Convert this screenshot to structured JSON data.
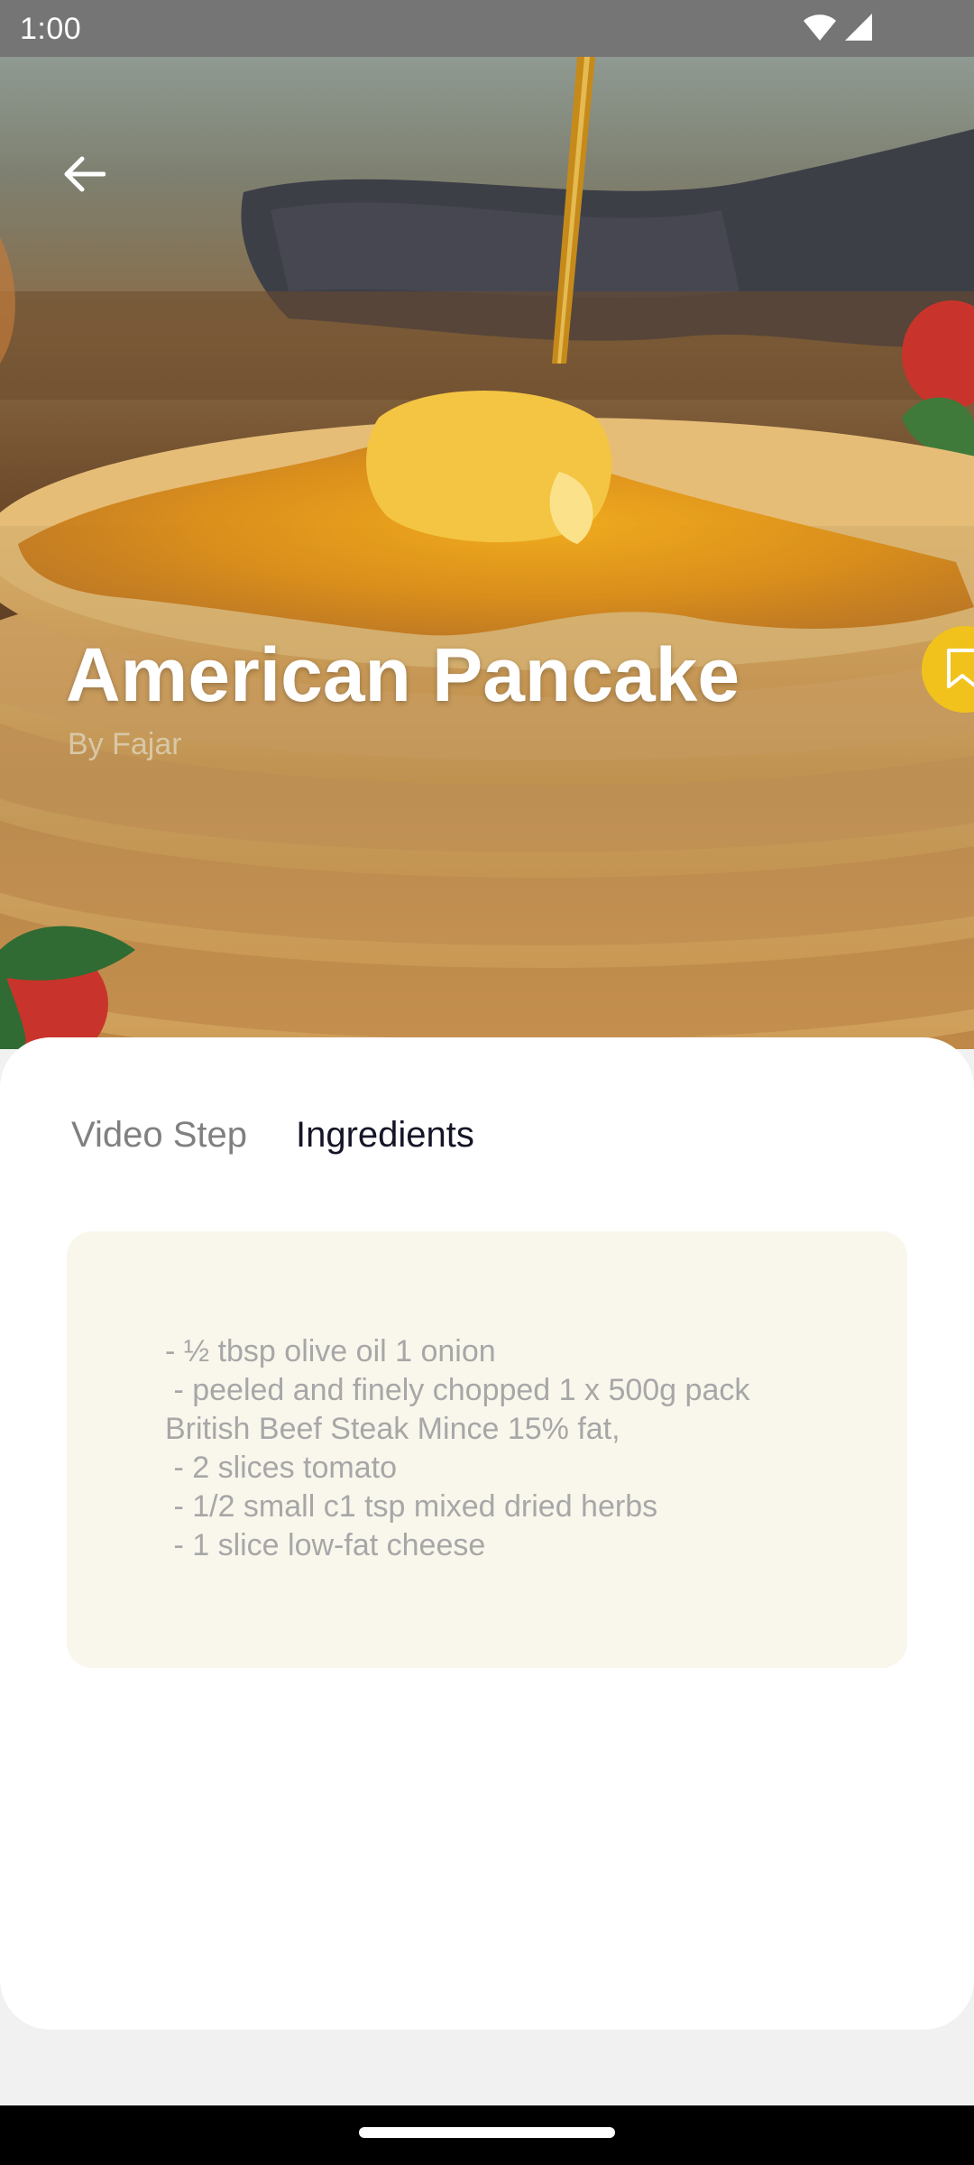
{
  "status_bar": {
    "time": "1:00",
    "icons": [
      "wifi-icon",
      "cell-signal-icon"
    ]
  },
  "hero": {
    "back_icon": "arrow-left-icon",
    "title": "American Pancake",
    "author": "By Fajar",
    "bookmark_icon": "bookmark-icon"
  },
  "tabs": [
    {
      "label": "Video Step",
      "active": false
    },
    {
      "label": "Ingredients",
      "active": true
    }
  ],
  "ingredients": {
    "text": "- ½ tbsp olive oil 1 onion\n - peeled and finely chopped 1 x 500g pack\nBritish Beef Steak Mince 15% fat,\n - 2 slices tomato\n - 1/2 small c1 tsp mixed dried herbs\n - 1 slice low-fat cheese"
  },
  "colors": {
    "accent": "#f1c21b",
    "active_tab": "#151527",
    "inactive_tab": "#808080",
    "card_background": "#f9f6ec"
  }
}
